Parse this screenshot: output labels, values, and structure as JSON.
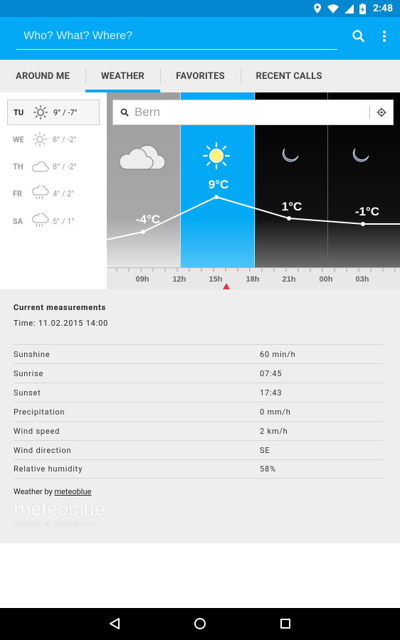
{
  "status_bar": {
    "time": "2:48",
    "icons": [
      "location-icon",
      "wifi-icon",
      "signal-icon",
      "battery-charging-icon"
    ]
  },
  "app_bar": {
    "search_placeholder": "Who? What? Where?",
    "icons": [
      "search-icon",
      "overflow-menu-icon"
    ]
  },
  "tabs": [
    {
      "label": "AROUND ME",
      "active": false
    },
    {
      "label": "WEATHER",
      "active": true
    },
    {
      "label": "FAVORITES",
      "active": false
    },
    {
      "label": "RECENT CALLS",
      "active": false
    }
  ],
  "days": [
    {
      "day": "TU",
      "icon": "sun-icon",
      "temp": "9° / -7°",
      "selected": true
    },
    {
      "day": "WE",
      "icon": "sun-icon",
      "temp": "8° / -2°",
      "selected": false
    },
    {
      "day": "TH",
      "icon": "cloud-icon",
      "temp": "8° / -2°",
      "selected": false
    },
    {
      "day": "FR",
      "icon": "rain-cloud-icon",
      "temp": "4° / 2°",
      "selected": false
    },
    {
      "day": "SA",
      "icon": "rain-cloud-icon",
      "temp": "5° / 1°",
      "selected": false
    }
  ],
  "forecast": {
    "city_search_value": "Bern",
    "icons": [
      "search-icon",
      "locate-icon"
    ],
    "periods": [
      {
        "icon": "cloud-icon",
        "label": "-4°C"
      },
      {
        "icon": "sun-icon",
        "label": "9°C"
      },
      {
        "icon": "moon-icon",
        "label": "1°C"
      },
      {
        "icon": "moon-icon",
        "label": "-1°C"
      }
    ],
    "time_labels": [
      "09h",
      "12h",
      "15h",
      "18h",
      "21h",
      "00h",
      "03h"
    ],
    "colors": {
      "overcast": "#9e9e9e",
      "day": "#03a9f4",
      "night": "#000000",
      "now_marker": "#e53935"
    }
  },
  "measurements": {
    "title": "Current measurements",
    "time": "Time: 11.02.2015  14:00",
    "rows": [
      {
        "label": "Sunshine",
        "value": "60 min/h"
      },
      {
        "label": "Sunrise",
        "value": "07:45"
      },
      {
        "label": "Sunset",
        "value": "17:43"
      },
      {
        "label": "Precipitation",
        "value": "0 mm/h"
      },
      {
        "label": "Wind speed",
        "value": "2 km/h"
      },
      {
        "label": "Wind direction",
        "value": "SE"
      },
      {
        "label": "Relative humidity",
        "value": "58%"
      }
    ],
    "credit_prefix": "Weather by ",
    "credit_link": "meteoblue",
    "logo_title": "meteoblue",
    "logo_tagline": "weather ☼ close to you"
  },
  "nav_bar": {
    "icons": [
      "back-icon",
      "home-icon",
      "recents-icon"
    ]
  }
}
